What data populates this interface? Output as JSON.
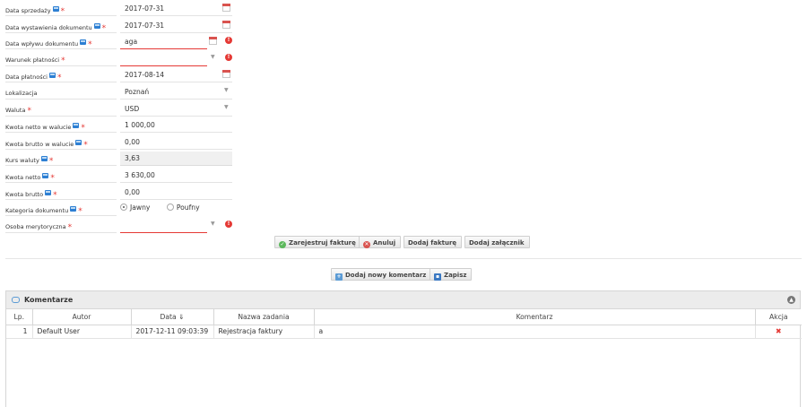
{
  "form": {
    "sale_date": {
      "label": "Data sprzedaży",
      "value": "2017-07-31"
    },
    "issue_date": {
      "label": "Data wystawienia dokumentu",
      "value": "2017-07-31"
    },
    "receipt_date": {
      "label": "Data wpływu dokumentu",
      "value": "aga"
    },
    "payment_terms": {
      "label": "Warunek płatności",
      "value": ""
    },
    "payment_date": {
      "label": "Data płatności",
      "value": "2017-08-14"
    },
    "location": {
      "label": "Lokalizacja",
      "value": "Poznań"
    },
    "currency": {
      "label": "Waluta",
      "value": "USD"
    },
    "net_in_currency": {
      "label": "Kwota netto w walucie",
      "value": "1 000,00"
    },
    "gross_in_currency": {
      "label": "Kwota brutto w walucie",
      "value": "0,00"
    },
    "exchange_rate": {
      "label": "Kurs waluty",
      "value": "3,63"
    },
    "net_amount": {
      "label": "Kwota netto",
      "value": "3 630,00"
    },
    "gross_amount": {
      "label": "Kwota brutto",
      "value": "0,00"
    },
    "doc_category": {
      "label": "Kategoria dokumentu",
      "options": [
        "Jawny",
        "Poufny"
      ],
      "selected": "Jawny"
    },
    "substantive_person": {
      "label": "Osoba merytoryczna",
      "value": ""
    }
  },
  "required_mark": "*",
  "actions": {
    "register": "Zarejestruj fakturę",
    "cancel": "Anuluj",
    "add_invoice": "Dodaj fakturę",
    "add_attachment": "Dodaj załącznik"
  },
  "comment_actions": {
    "add_comment": "Dodaj nowy komentarz",
    "save": "Zapisz"
  },
  "comments": {
    "title": "Komentarze",
    "columns": [
      "Lp.",
      "Autor",
      "Data ⇓",
      "Nazwa zadania",
      "Komentarz",
      "Akcja"
    ],
    "rows": [
      {
        "lp": "1",
        "author": "Default User",
        "date": "2017-12-11 09:03:39",
        "task": "Rejestracja faktury",
        "comment": "a"
      }
    ]
  },
  "colors": {
    "required": "#e53935",
    "accent": "#2d7fd3",
    "error": "#e53935"
  }
}
